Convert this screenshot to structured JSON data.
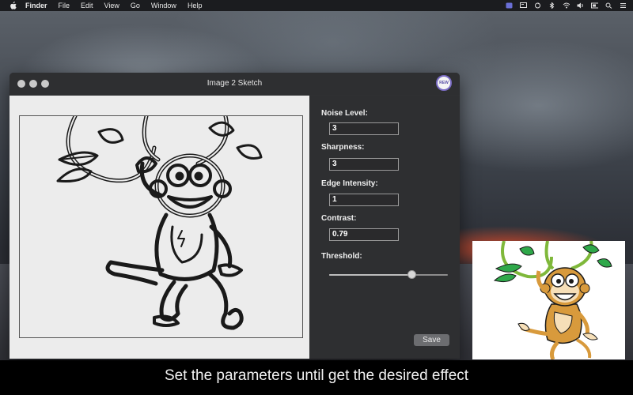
{
  "menubar": {
    "app_name": "Finder",
    "items": [
      "File",
      "Edit",
      "View",
      "Go",
      "Window",
      "Help"
    ],
    "status_icons": [
      "app-icon",
      "display-icon",
      "sync-icon",
      "bluetooth-icon",
      "wifi-icon",
      "volume-icon",
      "battery-icon",
      "spotlight-icon",
      "list-icon"
    ]
  },
  "window": {
    "title": "Image 2 Sketch",
    "badge": "REW"
  },
  "params": {
    "noise_label": "Noise Level:",
    "noise_value": "3",
    "sharpness_label": "Sharpness:",
    "sharpness_value": "3",
    "edge_label": "Edge Intensity:",
    "edge_value": "1",
    "contrast_label": "Contrast:",
    "contrast_value": "0.79",
    "threshold_label": "Threshold:",
    "threshold_level": 0.69,
    "save_label": "Save"
  },
  "caption": "Set the parameters until get the desired effect",
  "colors": {
    "menubar_bg": "#1b1c1f",
    "window_bg": "#2f3033",
    "canvas_bg": "#ececec",
    "monkey_fur": "#d89a3c",
    "leaf_green": "#2fa84a",
    "caption_bg": "#000000"
  }
}
